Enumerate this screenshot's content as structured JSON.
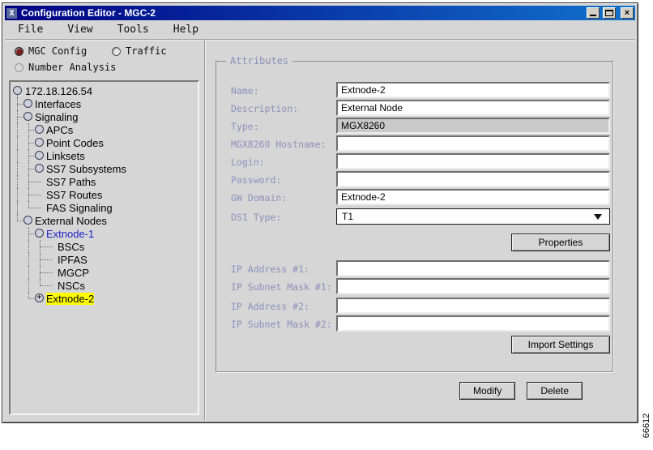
{
  "window": {
    "title": "Configuration Editor - MGC-2",
    "icon_label": "X"
  },
  "menubar": {
    "items": [
      "File",
      "View",
      "Tools",
      "Help"
    ]
  },
  "mode_panel": {
    "radios": [
      {
        "label": "MGC Config",
        "selected": true,
        "disabled": false
      },
      {
        "label": "Traffic",
        "selected": false,
        "disabled": false
      },
      {
        "label": "Number Analysis",
        "selected": false,
        "disabled": true
      }
    ]
  },
  "tree": {
    "rows": [
      {
        "label": "172.18.126.54",
        "level": 0,
        "toggle": true,
        "root": true
      },
      {
        "label": "Interfaces",
        "level": 1,
        "toggle": true,
        "elbow": 0
      },
      {
        "label": "Signaling",
        "level": 1,
        "toggle": true,
        "elbow": 0
      },
      {
        "label": "APCs",
        "level": 2,
        "toggle": true,
        "elbow": 1,
        "pass": [
          0
        ]
      },
      {
        "label": "Point Codes",
        "level": 2,
        "toggle": true,
        "elbow": 1,
        "pass": [
          0
        ]
      },
      {
        "label": "Linksets",
        "level": 2,
        "toggle": true,
        "elbow": 1,
        "pass": [
          0
        ]
      },
      {
        "label": "SS7 Subsystems",
        "level": 2,
        "toggle": true,
        "elbow": 1,
        "pass": [
          0
        ]
      },
      {
        "label": "SS7 Paths",
        "level": 2,
        "toggle": false,
        "elbow": 1,
        "pass": [
          0
        ]
      },
      {
        "label": "SS7 Routes",
        "level": 2,
        "toggle": false,
        "elbow": 1,
        "pass": [
          0
        ]
      },
      {
        "label": "FAS Signaling",
        "level": 2,
        "toggle": false,
        "elbow": 1,
        "pass": [
          0
        ],
        "last": true
      },
      {
        "label": "External Nodes",
        "level": 1,
        "toggle": true,
        "elbow": 0,
        "last": true
      },
      {
        "label": "Extnode-1",
        "level": 2,
        "toggle": true,
        "elbow": 1,
        "style": "selected-blue"
      },
      {
        "label": "BSCs",
        "level": 3,
        "toggle": false,
        "elbow": 2,
        "pass": [
          1
        ]
      },
      {
        "label": "IPFAS",
        "level": 3,
        "toggle": false,
        "elbow": 2,
        "pass": [
          1
        ]
      },
      {
        "label": "MGCP",
        "level": 3,
        "toggle": false,
        "elbow": 2,
        "pass": [
          1
        ]
      },
      {
        "label": "NSCs",
        "level": 3,
        "toggle": false,
        "elbow": 2,
        "pass": [
          1
        ],
        "last": true
      },
      {
        "label": "Extnode-2",
        "level": 2,
        "toggle": true,
        "elbow": 1,
        "last": true,
        "plus": true,
        "style": "highlight"
      }
    ]
  },
  "attributes": {
    "title": "Attributes",
    "fields": [
      {
        "label": "Name:",
        "value": "Extnode-2",
        "type": "text"
      },
      {
        "label": "Description:",
        "value": "External Node",
        "type": "text"
      },
      {
        "label": "Type:",
        "value": "MGX8260",
        "type": "readonly"
      },
      {
        "label": "MGX8260 Hostname:",
        "value": "",
        "type": "text"
      },
      {
        "label": "Login:",
        "value": "",
        "type": "text"
      },
      {
        "label": "Password:",
        "value": "",
        "type": "text"
      },
      {
        "label": "GW Domain:",
        "value": "Extnode-2",
        "type": "text"
      },
      {
        "label": "DS1 Type:",
        "value": "T1",
        "type": "dropdown"
      }
    ],
    "properties_button": "Properties",
    "ip_fields": [
      {
        "label": "IP Address #1:",
        "value": ""
      },
      {
        "label": "IP Subnet Mask #1:",
        "value": ""
      },
      {
        "label": "IP Address #2:",
        "value": ""
      },
      {
        "label": "IP Subnet Mask #2:",
        "value": ""
      }
    ],
    "import_button": "Import Settings"
  },
  "actions": {
    "modify": "Modify",
    "delete": "Delete"
  },
  "figure_number": "66612",
  "colors": {
    "label": "#8e90bd",
    "titlebar_start": "#000083",
    "titlebar_end": "#1272cc",
    "highlight": "#ffff00",
    "selected_node": "#1c24c8",
    "background": "#d6d6d6"
  }
}
